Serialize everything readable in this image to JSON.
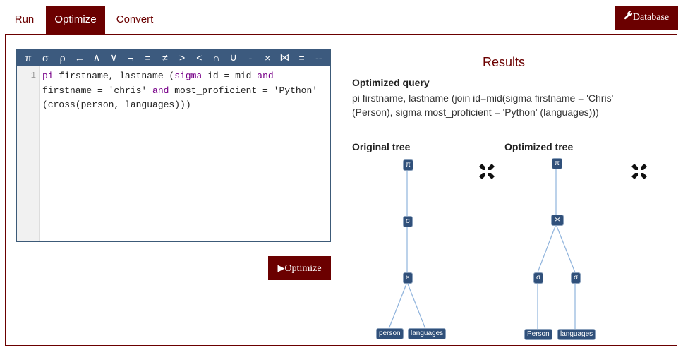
{
  "tabs": [
    {
      "label": "Run"
    },
    {
      "label": "Optimize"
    },
    {
      "label": "Convert"
    }
  ],
  "database_button": {
    "label": "Database",
    "icon": "wrench-icon"
  },
  "toolbar": {
    "symbols": [
      "π",
      "σ",
      "ρ",
      "←",
      "∧",
      "∨",
      "¬",
      "=",
      "≠",
      "≥",
      "≤",
      "∩",
      "∪",
      "-",
      "×",
      "⋈",
      "=",
      "--"
    ]
  },
  "editor": {
    "line_number": "1",
    "code_segments": [
      {
        "text": "pi",
        "kw": true
      },
      {
        "text": " firstname, lastname (",
        "kw": false
      },
      {
        "text": "sigma",
        "kw": true
      },
      {
        "text": " id = mid ",
        "kw": false
      },
      {
        "text": "and",
        "kw": true
      },
      {
        "text": "\nfirstname = 'chris' ",
        "kw": false
      },
      {
        "text": "and",
        "kw": true
      },
      {
        "text": " most_proficient = 'Python'\n(cross(person, languages)))",
        "kw": false
      }
    ]
  },
  "optimize_button": {
    "label": "Optimize",
    "icon": "play-icon"
  },
  "results": {
    "title": "Results",
    "optimized_query_title": "Optimized query",
    "optimized_query": "pi firstname, lastname (join id=mid(sigma firstname = 'Chris' (Person), sigma most_proficient = 'Python' (languages)))"
  },
  "original_tree": {
    "title": "Original tree",
    "nodes": [
      "π",
      "σ",
      "×",
      "person",
      "languages"
    ]
  },
  "optimized_tree": {
    "title": "Optimized tree",
    "nodes": [
      "π",
      "⋈",
      "σ",
      "σ",
      "Person",
      "languages"
    ]
  },
  "colors": {
    "accent": "#6b0000",
    "node": "#30507a",
    "edge": "#8fb3dc",
    "keyword": "#770088"
  }
}
